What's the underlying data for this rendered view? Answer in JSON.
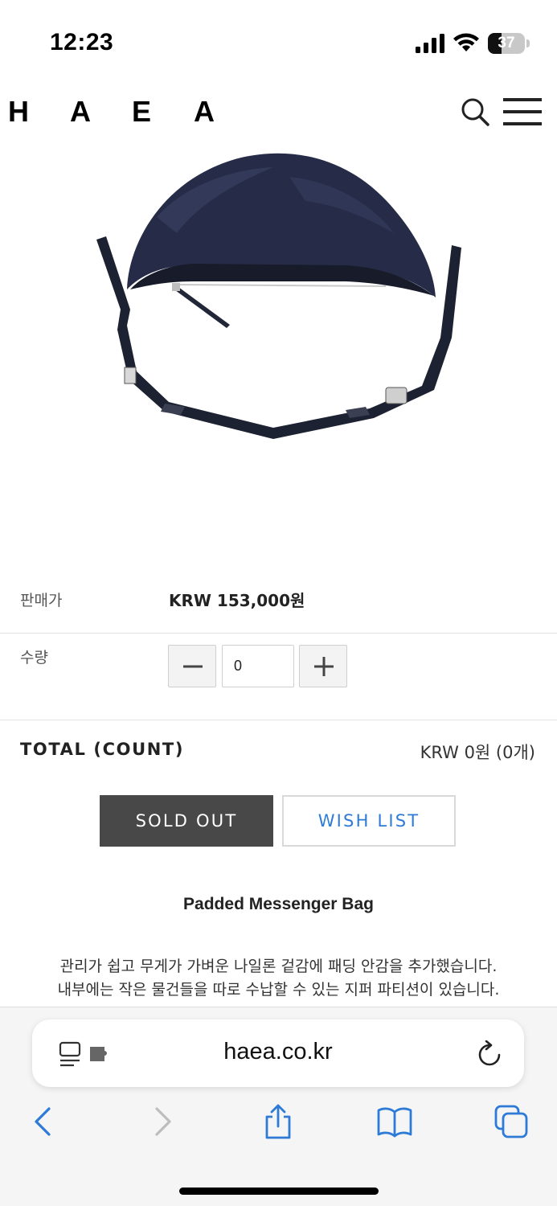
{
  "status_bar": {
    "time": "12:23",
    "battery_level": "37",
    "icons": [
      "signal-icon",
      "wifi-icon",
      "battery-icon"
    ]
  },
  "header": {
    "logo_letters": [
      "H",
      "A",
      "E",
      "A"
    ],
    "icons": [
      "search-icon",
      "menu-icon"
    ]
  },
  "product": {
    "image_desc": "navy padded messenger bag",
    "price_label": "판매가",
    "price_value": "KRW 153,000원",
    "quantity_label": "수량",
    "quantity_value": "0",
    "total_label": "TOTAL (COUNT)",
    "total_value": "KRW 0원 (0개)",
    "sold_out_label": "SOLD OUT",
    "wish_list_label": "WISH LIST",
    "name": "Padded Messenger Bag",
    "description_line1": "관리가 쉽고 무게가 가벼운 나일론 겉감에 패딩 안감을 추가했습니다.",
    "description_line2": "내부에는 작은 물건들을 따로 수납할 수 있는 지퍼 파티션이 있습니다."
  },
  "browser": {
    "url": "haea.co.kr",
    "icons": [
      "reader-icon",
      "extension-icon",
      "reload-icon",
      "back-icon",
      "forward-icon",
      "share-icon",
      "bookmarks-icon",
      "tabs-icon"
    ]
  },
  "colors": {
    "accent_blue": "#2d7bd6",
    "sold_out_bg": "#484848"
  }
}
